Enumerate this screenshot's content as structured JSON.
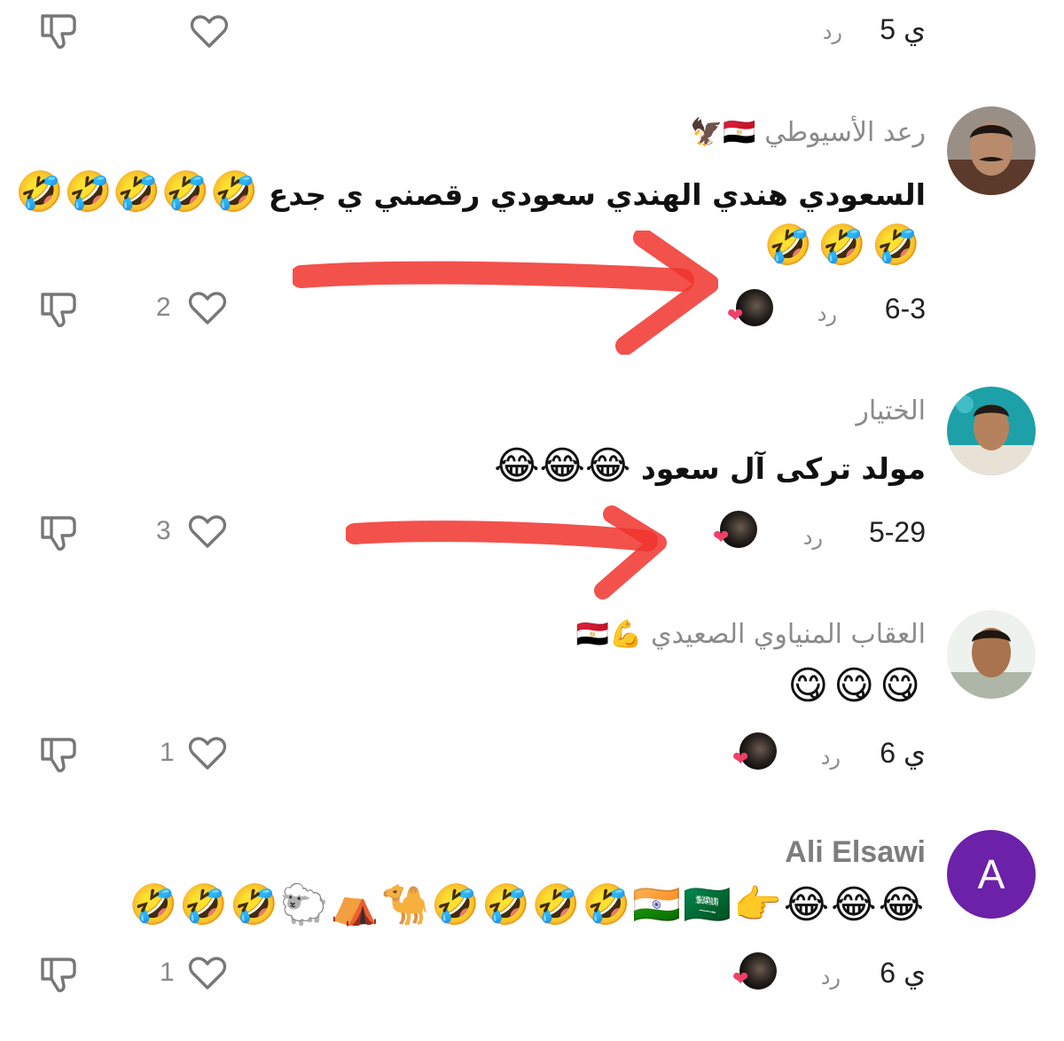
{
  "top_fragment": {
    "date": "5 ي",
    "reply_label": "رد"
  },
  "comments": [
    {
      "username": "رعد الأسيوطي 🇪🇬🦅",
      "text_line1": "السعودي هندي الهندي سعودي رقصني ي جدع",
      "text_line1_emojis": "🤣🤣🤣🤣🤣",
      "text_line2": "🤣🤣🤣",
      "date": "6-3",
      "reply_label": "رد",
      "likes": "2",
      "liked_by_creator": true
    },
    {
      "username": "الختيار",
      "text_line1": "مولد تركى آل سعود",
      "text_line1_emojis": "😂😂😂",
      "date": "5-29",
      "reply_label": "رد",
      "likes": "3",
      "liked_by_creator": true
    },
    {
      "username": "العقاب المنياوي الصعيدي",
      "username_emojis": "💪🇪🇬",
      "text_line1": "😋😋😋",
      "date": "6 ي",
      "reply_label": "رد",
      "likes": "1",
      "liked_by_creator": true
    },
    {
      "username": "Ali Elsawi",
      "avatar_letter": "A",
      "text_line1": "😂😂😂👉🇮🇳🇸🇦🤣🤣🤣🤣🐪⛺🐑🤣🤣🤣",
      "date": "6 ي",
      "reply_label": "رد",
      "likes": "1",
      "liked_by_creator": true
    }
  ],
  "annotations": {
    "arrow_color": "#f0322d"
  },
  "icons": {
    "like": "heart-outline-icon",
    "dislike": "thumbs-down-icon",
    "creator_like": "heart-badge-icon"
  }
}
